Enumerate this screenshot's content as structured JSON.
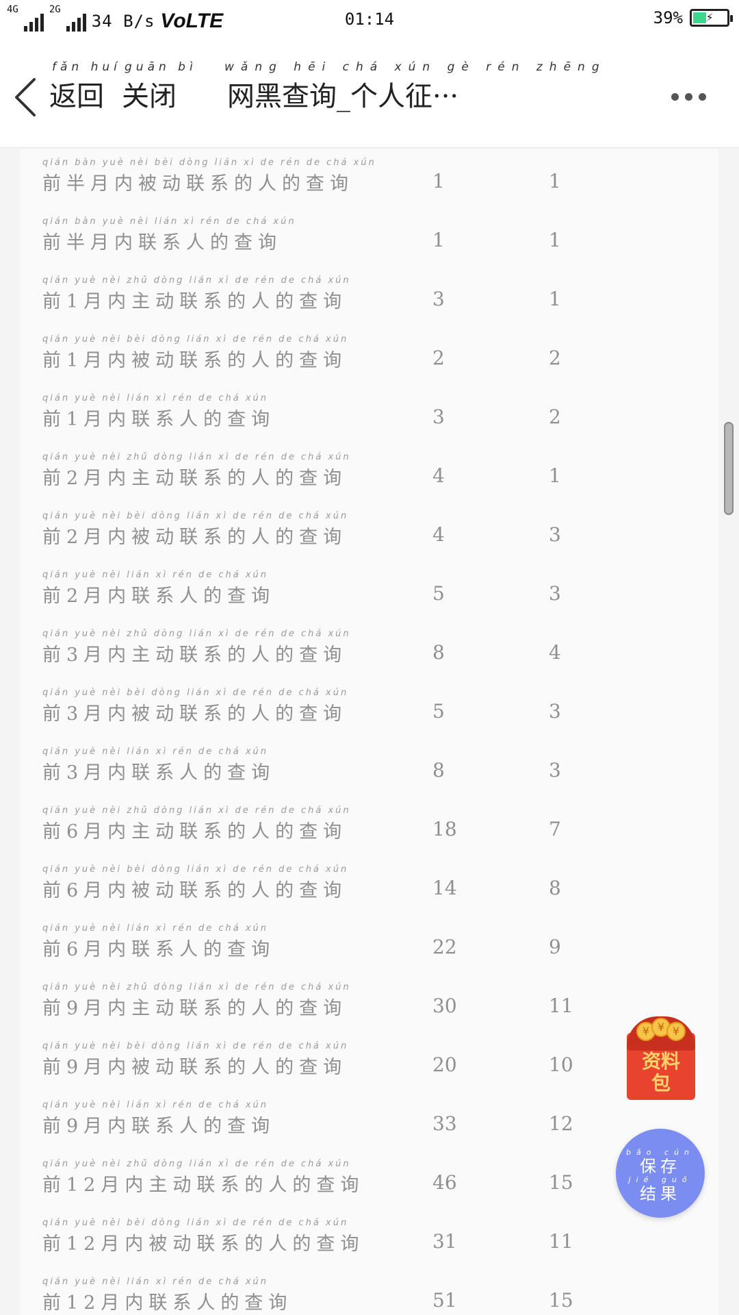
{
  "status_bar": {
    "net_top": "4G",
    "net_second": "2G",
    "speed": "34 B/s",
    "volte": "VoLTE",
    "time": "01:14",
    "battery_percent": "39%",
    "battery_level": 0.39,
    "battery_color": "#3dd68c"
  },
  "nav": {
    "back_label": "返回",
    "back_pinyin": "fǎn huí",
    "close_label": "关闭",
    "close_pinyin": "guān bì",
    "title": "网黑查询_个人征···",
    "title_pinyin": "wǎng hēi chá xún gè rén zhēng",
    "more_icon": "more-dots-icon"
  },
  "rows": [
    {
      "pinyin": "qián bàn yuè nèi bèi dòng lián xì de rén de chá xún",
      "label": "前半月内被动联系的人的查询",
      "v1": "1",
      "v2": "1"
    },
    {
      "pinyin": "qián bàn yuè nèi lián xì rén de chá xún",
      "label": "前半月内联系人的查询",
      "v1": "1",
      "v2": "1"
    },
    {
      "pinyin": "qián yuè nèi zhǔ dòng lián xì de rén de chá xún",
      "label": "前1月内主动联系的人的查询",
      "v1": "3",
      "v2": "1"
    },
    {
      "pinyin": "qián yuè nèi bèi dòng lián xì de rén de chá xún",
      "label": "前1月内被动联系的人的查询",
      "v1": "2",
      "v2": "2"
    },
    {
      "pinyin": "qián yuè nèi lián xì rén de chá xún",
      "label": "前1月内联系人的查询",
      "v1": "3",
      "v2": "2"
    },
    {
      "pinyin": "qián yuè nèi zhǔ dòng lián xì de rén de chá xún",
      "label": "前2月内主动联系的人的查询",
      "v1": "4",
      "v2": "1"
    },
    {
      "pinyin": "qián yuè nèi bèi dòng lián xì de rén de chá xún",
      "label": "前2月内被动联系的人的查询",
      "v1": "4",
      "v2": "3"
    },
    {
      "pinyin": "qián yuè nèi lián xì rén de chá xún",
      "label": "前2月内联系人的查询",
      "v1": "5",
      "v2": "3"
    },
    {
      "pinyin": "qián yuè nèi zhǔ dòng lián xì de rén de chá xún",
      "label": "前3月内主动联系的人的查询",
      "v1": "8",
      "v2": "4"
    },
    {
      "pinyin": "qián yuè nèi bèi dòng lián xì de rén de chá xún",
      "label": "前3月内被动联系的人的查询",
      "v1": "5",
      "v2": "3"
    },
    {
      "pinyin": "qián yuè nèi lián xì rén de chá xún",
      "label": "前3月内联系人的查询",
      "v1": "8",
      "v2": "3"
    },
    {
      "pinyin": "qián yuè nèi zhǔ dòng lián xì de rén de chá xún",
      "label": "前6月内主动联系的人的查询",
      "v1": "18",
      "v2": "7"
    },
    {
      "pinyin": "qián yuè nèi bèi dòng lián xì de rén de chá xún",
      "label": "前6月内被动联系的人的查询",
      "v1": "14",
      "v2": "8"
    },
    {
      "pinyin": "qián yuè nèi lián xì rén de chá xún",
      "label": "前6月内联系人的查询",
      "v1": "22",
      "v2": "9"
    },
    {
      "pinyin": "qián yuè nèi zhǔ dòng lián xì de rén de chá xún",
      "label": "前9月内主动联系的人的查询",
      "v1": "30",
      "v2": "11"
    },
    {
      "pinyin": "qián yuè nèi bèi dòng lián xì de rén de chá xún",
      "label": "前9月内被动联系的人的查询",
      "v1": "20",
      "v2": "10"
    },
    {
      "pinyin": "qián yuè nèi lián xì rén de chá xún",
      "label": "前9月内联系人的查询",
      "v1": "33",
      "v2": "12"
    },
    {
      "pinyin": "qián yuè nèi zhǔ dòng lián xì de rén de chá xún",
      "label": "前12月内主动联系的人的查询",
      "v1": "46",
      "v2": "15"
    },
    {
      "pinyin": "qián yuè nèi bèi dòng lián xì de rén de chá xún",
      "label": "前12月内被动联系的人的查询",
      "v1": "31",
      "v2": "11"
    },
    {
      "pinyin": "qián yuè nèi lián xì rén de chá xún",
      "label": "前12月内联系人的查询",
      "v1": "51",
      "v2": "15"
    }
  ],
  "float": {
    "red_packet_label": "资料包",
    "red_packet_line1": "资料",
    "red_packet_line2": "包",
    "coin_symbol": "¥",
    "save_pinyin_top": "bǎo cún",
    "save_line1": "保存",
    "save_pinyin_mid": "jié guǒ",
    "save_line2": "结果"
  },
  "colors": {
    "save_button": "#7b8df0",
    "red_packet": "#e8432f"
  }
}
